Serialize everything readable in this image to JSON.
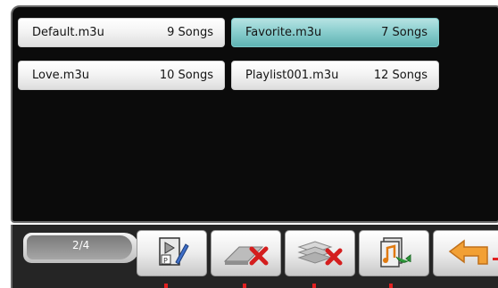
{
  "playlists": [
    {
      "name": "Default.m3u",
      "count": "9 Songs",
      "selected": false
    },
    {
      "name": "Favorite.m3u",
      "count": "7 Songs",
      "selected": true
    },
    {
      "name": "Love.m3u",
      "count": "10 Songs",
      "selected": false
    },
    {
      "name": "Playlist001.m3u",
      "count": "12 Songs",
      "selected": false
    }
  ],
  "pager": {
    "text": "2/4"
  },
  "toolbar": {
    "buttons": [
      {
        "name": "edit-playlist",
        "icon": "play-document-pencil-icon"
      },
      {
        "name": "delete",
        "icon": "eraser-x-icon"
      },
      {
        "name": "delete-all",
        "icon": "layers-x-icon"
      },
      {
        "name": "export",
        "icon": "music-document-arrow-icon"
      },
      {
        "name": "back",
        "icon": "back-arrow-icon"
      }
    ]
  },
  "colors": {
    "selected": "#8ccfcf",
    "panel": "#0b0b0b",
    "toolbar": "#252525",
    "marker": "#e02020",
    "back_arrow": "#f2a034"
  }
}
